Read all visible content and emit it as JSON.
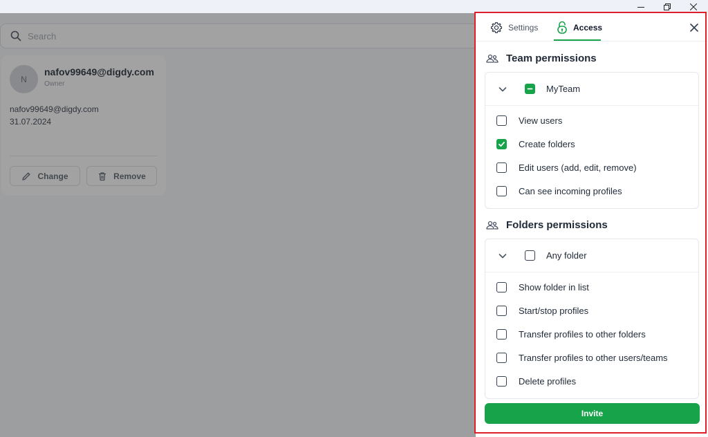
{
  "search": {
    "placeholder": "Search"
  },
  "user_card": {
    "avatar_initial": "N",
    "name": "nafov99649@digdy.com",
    "role": "Owner",
    "email": "nafov99649@digdy.com",
    "date": "31.07.2024",
    "change_label": "Change",
    "remove_label": "Remove"
  },
  "panel": {
    "tabs": [
      {
        "label": "Settings",
        "icon": "gear-icon",
        "active": false
      },
      {
        "label": "Access",
        "icon": "lock-icon",
        "active": true
      }
    ],
    "team_permissions": {
      "title": "Team permissions",
      "team": {
        "name": "MyTeam",
        "state": "indeterminate"
      },
      "items": [
        {
          "label": "View users",
          "checked": false
        },
        {
          "label": "Create folders",
          "checked": true
        },
        {
          "label": "Edit users (add, edit, remove)",
          "checked": false
        },
        {
          "label": "Can see incoming profiles",
          "checked": false
        }
      ]
    },
    "folder_permissions": {
      "title": "Folders permissions",
      "folder": {
        "name": "Any folder",
        "state": "unchecked"
      },
      "items": [
        {
          "label": "Show folder in list",
          "checked": false
        },
        {
          "label": "Start/stop profiles",
          "checked": false
        },
        {
          "label": "Transfer profiles to other folders",
          "checked": false
        },
        {
          "label": "Transfer profiles to other users/teams",
          "checked": false
        },
        {
          "label": "Delete profiles",
          "checked": false
        }
      ]
    },
    "invite_label": "Invite"
  },
  "colors": {
    "accent": "#16a34a",
    "highlight_frame": "#e11d2a"
  }
}
